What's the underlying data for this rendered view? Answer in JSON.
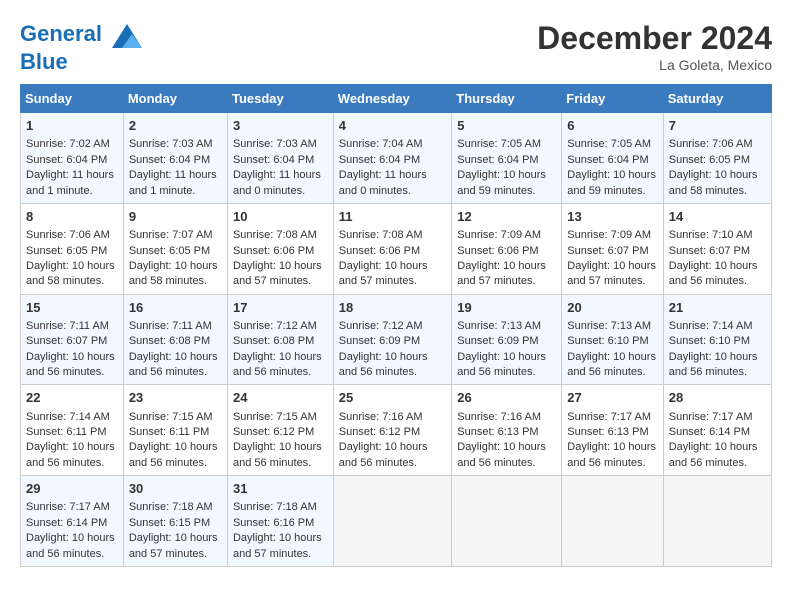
{
  "header": {
    "logo_line1": "General",
    "logo_line2": "Blue",
    "title": "December 2024",
    "subtitle": "La Goleta, Mexico"
  },
  "days_of_week": [
    "Sunday",
    "Monday",
    "Tuesday",
    "Wednesday",
    "Thursday",
    "Friday",
    "Saturday"
  ],
  "weeks": [
    [
      {
        "day": "1",
        "sunrise": "Sunrise: 7:02 AM",
        "sunset": "Sunset: 6:04 PM",
        "daylight": "Daylight: 11 hours and 1 minute."
      },
      {
        "day": "2",
        "sunrise": "Sunrise: 7:03 AM",
        "sunset": "Sunset: 6:04 PM",
        "daylight": "Daylight: 11 hours and 1 minute."
      },
      {
        "day": "3",
        "sunrise": "Sunrise: 7:03 AM",
        "sunset": "Sunset: 6:04 PM",
        "daylight": "Daylight: 11 hours and 0 minutes."
      },
      {
        "day": "4",
        "sunrise": "Sunrise: 7:04 AM",
        "sunset": "Sunset: 6:04 PM",
        "daylight": "Daylight: 11 hours and 0 minutes."
      },
      {
        "day": "5",
        "sunrise": "Sunrise: 7:05 AM",
        "sunset": "Sunset: 6:04 PM",
        "daylight": "Daylight: 10 hours and 59 minutes."
      },
      {
        "day": "6",
        "sunrise": "Sunrise: 7:05 AM",
        "sunset": "Sunset: 6:04 PM",
        "daylight": "Daylight: 10 hours and 59 minutes."
      },
      {
        "day": "7",
        "sunrise": "Sunrise: 7:06 AM",
        "sunset": "Sunset: 6:05 PM",
        "daylight": "Daylight: 10 hours and 58 minutes."
      }
    ],
    [
      {
        "day": "8",
        "sunrise": "Sunrise: 7:06 AM",
        "sunset": "Sunset: 6:05 PM",
        "daylight": "Daylight: 10 hours and 58 minutes."
      },
      {
        "day": "9",
        "sunrise": "Sunrise: 7:07 AM",
        "sunset": "Sunset: 6:05 PM",
        "daylight": "Daylight: 10 hours and 58 minutes."
      },
      {
        "day": "10",
        "sunrise": "Sunrise: 7:08 AM",
        "sunset": "Sunset: 6:06 PM",
        "daylight": "Daylight: 10 hours and 57 minutes."
      },
      {
        "day": "11",
        "sunrise": "Sunrise: 7:08 AM",
        "sunset": "Sunset: 6:06 PM",
        "daylight": "Daylight: 10 hours and 57 minutes."
      },
      {
        "day": "12",
        "sunrise": "Sunrise: 7:09 AM",
        "sunset": "Sunset: 6:06 PM",
        "daylight": "Daylight: 10 hours and 57 minutes."
      },
      {
        "day": "13",
        "sunrise": "Sunrise: 7:09 AM",
        "sunset": "Sunset: 6:07 PM",
        "daylight": "Daylight: 10 hours and 57 minutes."
      },
      {
        "day": "14",
        "sunrise": "Sunrise: 7:10 AM",
        "sunset": "Sunset: 6:07 PM",
        "daylight": "Daylight: 10 hours and 56 minutes."
      }
    ],
    [
      {
        "day": "15",
        "sunrise": "Sunrise: 7:11 AM",
        "sunset": "Sunset: 6:07 PM",
        "daylight": "Daylight: 10 hours and 56 minutes."
      },
      {
        "day": "16",
        "sunrise": "Sunrise: 7:11 AM",
        "sunset": "Sunset: 6:08 PM",
        "daylight": "Daylight: 10 hours and 56 minutes."
      },
      {
        "day": "17",
        "sunrise": "Sunrise: 7:12 AM",
        "sunset": "Sunset: 6:08 PM",
        "daylight": "Daylight: 10 hours and 56 minutes."
      },
      {
        "day": "18",
        "sunrise": "Sunrise: 7:12 AM",
        "sunset": "Sunset: 6:09 PM",
        "daylight": "Daylight: 10 hours and 56 minutes."
      },
      {
        "day": "19",
        "sunrise": "Sunrise: 7:13 AM",
        "sunset": "Sunset: 6:09 PM",
        "daylight": "Daylight: 10 hours and 56 minutes."
      },
      {
        "day": "20",
        "sunrise": "Sunrise: 7:13 AM",
        "sunset": "Sunset: 6:10 PM",
        "daylight": "Daylight: 10 hours and 56 minutes."
      },
      {
        "day": "21",
        "sunrise": "Sunrise: 7:14 AM",
        "sunset": "Sunset: 6:10 PM",
        "daylight": "Daylight: 10 hours and 56 minutes."
      }
    ],
    [
      {
        "day": "22",
        "sunrise": "Sunrise: 7:14 AM",
        "sunset": "Sunset: 6:11 PM",
        "daylight": "Daylight: 10 hours and 56 minutes."
      },
      {
        "day": "23",
        "sunrise": "Sunrise: 7:15 AM",
        "sunset": "Sunset: 6:11 PM",
        "daylight": "Daylight: 10 hours and 56 minutes."
      },
      {
        "day": "24",
        "sunrise": "Sunrise: 7:15 AM",
        "sunset": "Sunset: 6:12 PM",
        "daylight": "Daylight: 10 hours and 56 minutes."
      },
      {
        "day": "25",
        "sunrise": "Sunrise: 7:16 AM",
        "sunset": "Sunset: 6:12 PM",
        "daylight": "Daylight: 10 hours and 56 minutes."
      },
      {
        "day": "26",
        "sunrise": "Sunrise: 7:16 AM",
        "sunset": "Sunset: 6:13 PM",
        "daylight": "Daylight: 10 hours and 56 minutes."
      },
      {
        "day": "27",
        "sunrise": "Sunrise: 7:17 AM",
        "sunset": "Sunset: 6:13 PM",
        "daylight": "Daylight: 10 hours and 56 minutes."
      },
      {
        "day": "28",
        "sunrise": "Sunrise: 7:17 AM",
        "sunset": "Sunset: 6:14 PM",
        "daylight": "Daylight: 10 hours and 56 minutes."
      }
    ],
    [
      {
        "day": "29",
        "sunrise": "Sunrise: 7:17 AM",
        "sunset": "Sunset: 6:14 PM",
        "daylight": "Daylight: 10 hours and 56 minutes."
      },
      {
        "day": "30",
        "sunrise": "Sunrise: 7:18 AM",
        "sunset": "Sunset: 6:15 PM",
        "daylight": "Daylight: 10 hours and 57 minutes."
      },
      {
        "day": "31",
        "sunrise": "Sunrise: 7:18 AM",
        "sunset": "Sunset: 6:16 PM",
        "daylight": "Daylight: 10 hours and 57 minutes."
      },
      null,
      null,
      null,
      null
    ]
  ]
}
